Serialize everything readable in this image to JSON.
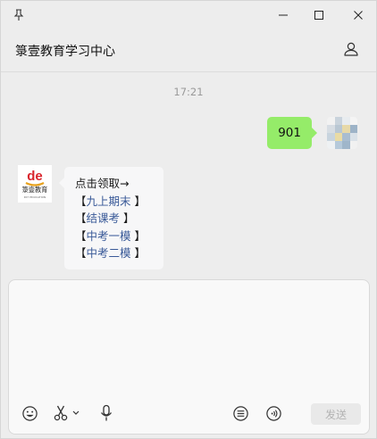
{
  "window": {
    "title": "箓壹教育学习中心"
  },
  "chat": {
    "timestamp": "17:21",
    "messages": [
      {
        "direction": "sent",
        "text": "901"
      },
      {
        "direction": "received",
        "lines": [
          {
            "prefix": "点击领取→",
            "link": "",
            "suffix": ""
          },
          {
            "prefix": "【",
            "link": "九上期末",
            "suffix": " 】"
          },
          {
            "prefix": "【",
            "link": "结课考",
            "suffix": " 】"
          },
          {
            "prefix": "【",
            "link": "中考一模",
            "suffix": " 】"
          },
          {
            "prefix": "【",
            "link": "中考二模",
            "suffix": " 】"
          }
        ]
      }
    ],
    "sender_logo_text": "de",
    "sender_logo_name": "箓壹教育",
    "sender_logo_sub": "DIYI EDUCATION"
  },
  "input": {
    "send_label": "发送"
  },
  "icons": {
    "pin": "pin-icon",
    "minimize": "minimize-icon",
    "maximize": "maximize-icon",
    "close": "close-icon",
    "profile": "person-icon",
    "emoji": "emoji-icon",
    "scissors": "scissors-icon",
    "microphone": "microphone-icon",
    "chat-history": "chat-history-icon",
    "voice-call": "voice-call-icon"
  },
  "colors": {
    "sent_bubble": "#95ec69",
    "link": "#3a5a98",
    "logo_red": "#d9242c"
  }
}
